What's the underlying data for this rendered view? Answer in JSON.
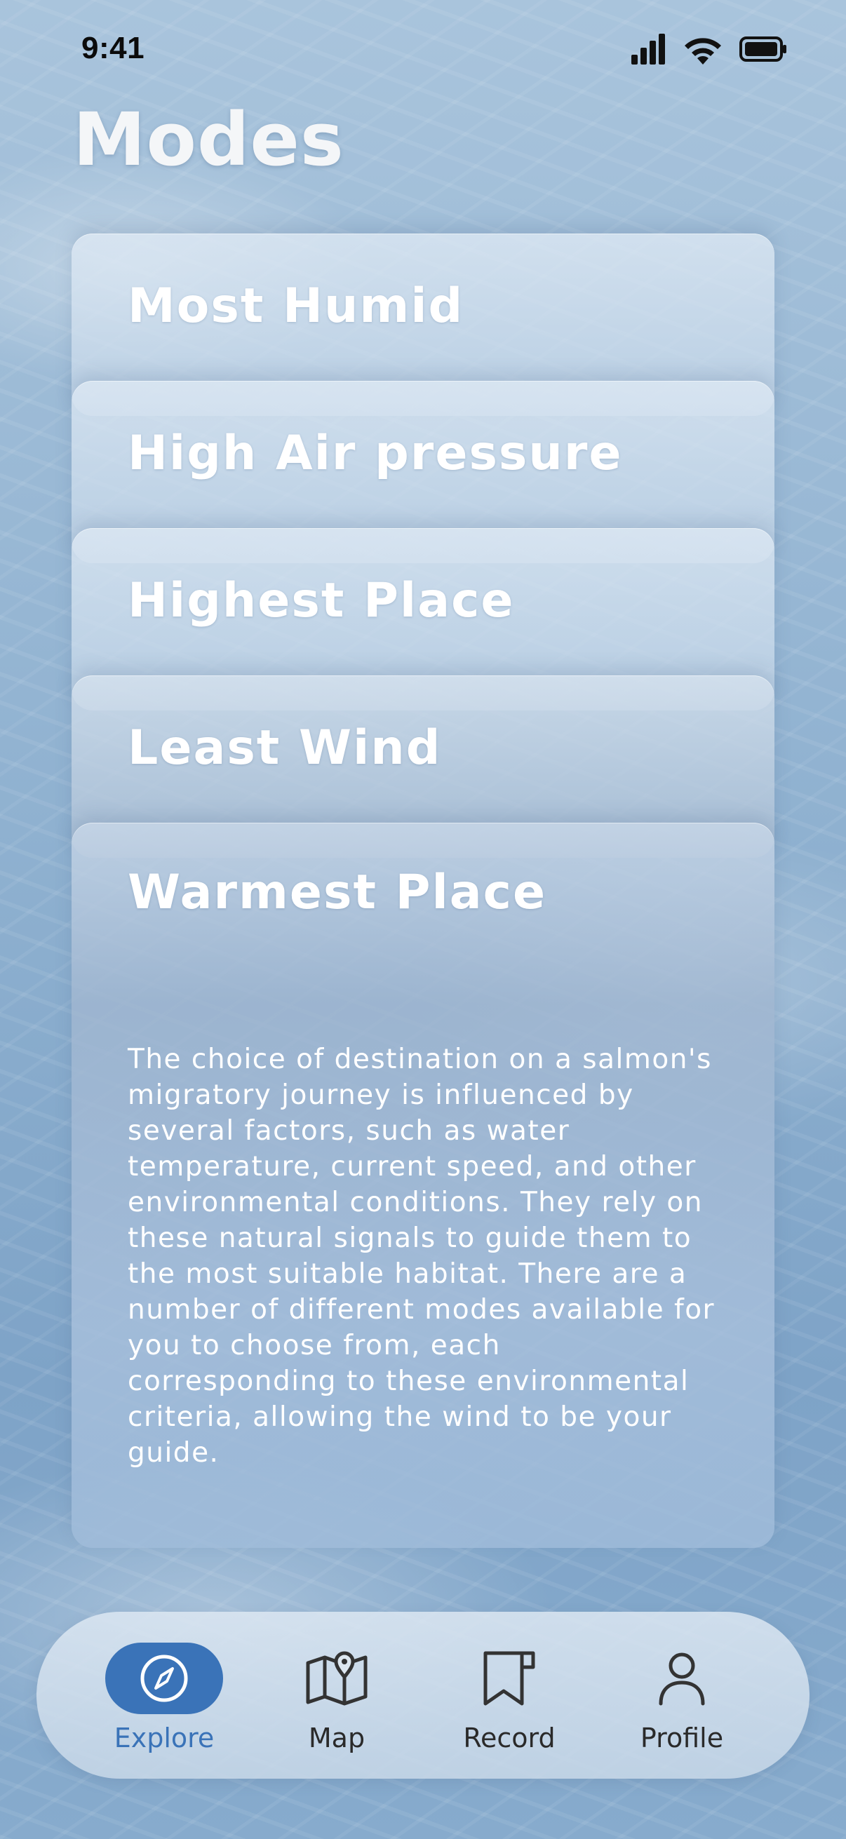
{
  "status_bar": {
    "time": "9:41",
    "icons": [
      "cellular-signal-icon",
      "wifi-icon",
      "battery-icon"
    ]
  },
  "page": {
    "title": "Modes"
  },
  "modes": [
    {
      "label": "Most Humid"
    },
    {
      "label": "High Air pressure"
    },
    {
      "label": "Highest Place"
    },
    {
      "label": "Least Wind"
    },
    {
      "label": "Warmest Place",
      "description": "The choice of destination on a salmon's migratory journey is influenced by several factors, such as water temperature, current speed, and other environmental conditions. They rely on these natural signals to guide them to the most suitable habitat. There are a number of different modes available for you to choose from, each corresponding to these environmental criteria, allowing the wind to be your guide."
    }
  ],
  "tab_bar": {
    "tabs": [
      {
        "label": "Explore",
        "icon": "compass-icon",
        "active": true
      },
      {
        "label": "Map",
        "icon": "map-icon",
        "active": false
      },
      {
        "label": "Record",
        "icon": "bookmark-icon",
        "active": false
      },
      {
        "label": "Profile",
        "icon": "person-icon",
        "active": false
      }
    ]
  },
  "colors": {
    "accent": "#3a73b8",
    "title_text": "#f4f6f8",
    "card_text": "#ffffff"
  }
}
